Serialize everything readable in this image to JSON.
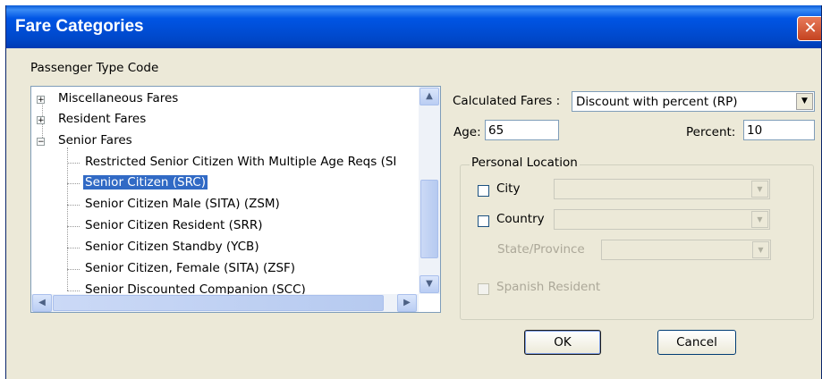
{
  "window": {
    "title": "Fare Categories",
    "close_glyph": "✕"
  },
  "passenger_type_code": {
    "label": "Passenger Type Code",
    "tree": [
      {
        "label": "Miscellaneous Fares",
        "expander": "+",
        "selected": false
      },
      {
        "label": "Resident Fares",
        "expander": "+",
        "selected": false
      },
      {
        "label": "Senior Fares",
        "expander": "−",
        "selected": false
      },
      {
        "label": "Restricted Senior Citizen With Multiple Age Reqs (SI",
        "selected": false
      },
      {
        "label": "Senior Citizen (SRC)",
        "selected": true
      },
      {
        "label": "Senior Citizen Male (SITA) (ZSM)",
        "selected": false
      },
      {
        "label": "Senior Citizen Resident (SRR)",
        "selected": false
      },
      {
        "label": "Senior Citizen Standby (YCB)",
        "selected": false
      },
      {
        "label": "Senior Citizen, Female  (SITA) (ZSF)",
        "selected": false
      },
      {
        "label": "Senior Discounted Companion (SCC)",
        "selected": false
      }
    ]
  },
  "calculated_fares": {
    "label": "Calculated Fares :",
    "value": "Discount with percent (RP)"
  },
  "age": {
    "label": "Age:",
    "value": "65"
  },
  "percent": {
    "label": "Percent:",
    "value": "10"
  },
  "personal_location": {
    "title": "Personal Location",
    "city_label": "City",
    "country_label": "Country",
    "state_label": "State/Province",
    "spanish_resident_label": "Spanish Resident"
  },
  "buttons": {
    "ok": "OK",
    "cancel": "Cancel"
  }
}
